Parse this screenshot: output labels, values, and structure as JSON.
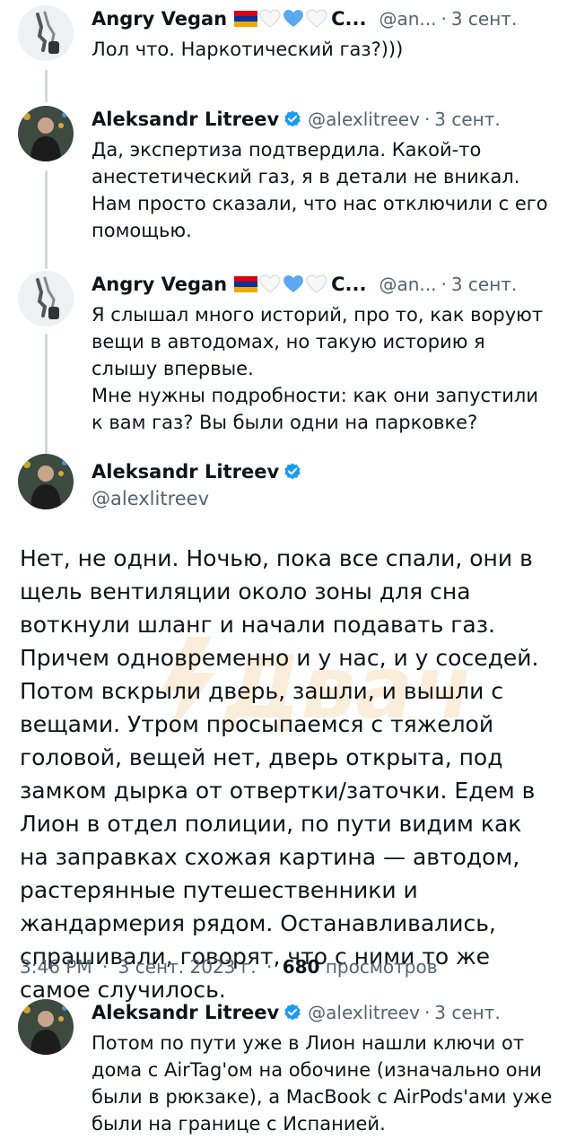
{
  "tweets": [
    {
      "name": "Angry Vegan",
      "name_suffix": "C...",
      "handle": "@an...",
      "sep": "·",
      "date": "3 сент.",
      "text": [
        "Лол что. Наркотический газ?)))"
      ]
    },
    {
      "name": "Aleksandr Litreev",
      "handle": "@alexlitreev",
      "sep": "·",
      "date": "3 сент.",
      "text": [
        "Да, экспертиза подтвердила. Какой-то анестетический газ, я в детали не вникал. Нам просто сказали, что нас отключили с его помощью."
      ]
    },
    {
      "name": "Angry Vegan",
      "name_suffix": "C...",
      "handle": "@an...",
      "sep": "·",
      "date": "3 сент.",
      "text": [
        "Я слышал много историй, про то, как воруют вещи в автодомах, но такую историю я слышу впервые.",
        "Мне нужны подробности: как они запустили к вам газ? Вы были одни на парковке?"
      ]
    }
  ],
  "focused": {
    "name": "Aleksandr Litreev",
    "handle": "@alexlitreev",
    "text": "Нет, не одни. Ночью, пока все спали, они в щель вентиляции около зоны для сна воткнули шланг и начали подавать газ. Причем одновременно и у нас, и у соседей. Потом вскрыли дверь, зашли, и вышли с вещами. Утром просыпаемся с тяжелой головой, вещей нет, дверь открыта, под замком дырка от отвертки/заточки. Едем в Лион в отдел полиции, по пути видим как на заправках схожая картина — автодом, растерянные путешественники и жандармерия рядом. Останавливались, спрашивали, говорят, что с ними то же самое случилось.",
    "time": "3:46 PM",
    "sep": "·",
    "full_date": "3 сент. 2023 г.",
    "views_count": "680",
    "views_label": "просмотров"
  },
  "reply": {
    "name": "Aleksandr Litreev",
    "handle": "@alexlitreev",
    "sep": "·",
    "date": "3 сент.",
    "text": "Потом по пути уже в Лион нашли ключи от дома с AirTag'ом на обочине (изначально они были в рюкзаке), а MacBook с AirPods'ами уже были на границе с Испанией."
  },
  "watermark_text": "Двач",
  "colors": {
    "text": "#0f1419",
    "secondary": "#536471",
    "verified": "#1d9bf0",
    "thread_line": "#cfd9de"
  },
  "icons": [
    "verified-badge-icon",
    "armenia-flag-icon",
    "white-heart-icon",
    "blue-heart-icon"
  ]
}
